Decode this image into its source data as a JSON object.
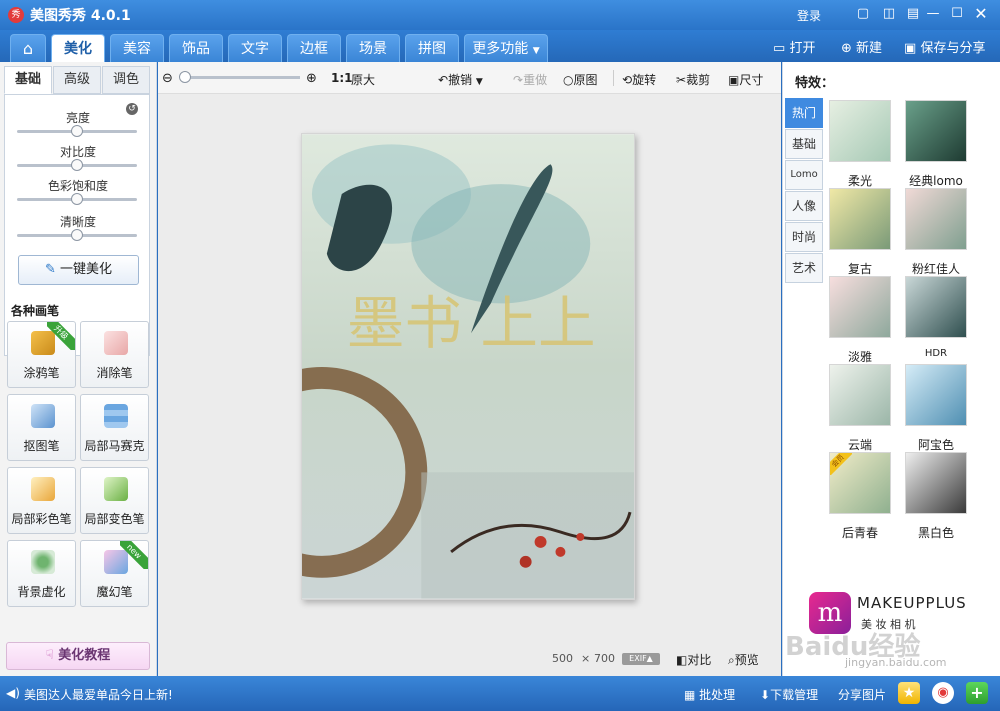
{
  "app": {
    "title": "美图秀秀 4.0.1",
    "logo_char": "秀",
    "login": "登录"
  },
  "window_controls": [
    "chat-icon",
    "skin-icon",
    "menu-icon",
    "minimize-icon",
    "maximize-icon",
    "close-icon"
  ],
  "nav": {
    "home_icon": "home-icon",
    "tabs": [
      "美化",
      "美容",
      "饰品",
      "文字",
      "边框",
      "场景",
      "拼图",
      "更多功能"
    ],
    "active_tab": "美化",
    "open": "打开",
    "new": "新建",
    "save_share": "保存与分享"
  },
  "left": {
    "subtabs": [
      "基础",
      "高级",
      "调色"
    ],
    "active_subtab": "基础",
    "sliders": [
      {
        "label": "亮度",
        "level": 0.5
      },
      {
        "label": "对比度",
        "level": 0.5
      },
      {
        "label": "色彩饱和度",
        "level": 0.5
      },
      {
        "label": "清晰度",
        "level": 0.5
      }
    ],
    "one_click": "一键美化",
    "brushes_title": "各种画笔",
    "tools": [
      {
        "label": "涂鸦笔",
        "badge": "升级"
      },
      {
        "label": "消除笔",
        "badge": ""
      },
      {
        "label": "抠图笔",
        "badge": ""
      },
      {
        "label": "局部马赛克",
        "badge": ""
      },
      {
        "label": "局部彩色笔",
        "badge": ""
      },
      {
        "label": "局部变色笔",
        "badge": ""
      },
      {
        "label": "背景虚化",
        "badge": ""
      },
      {
        "label": "魔幻笔",
        "badge": "new"
      }
    ],
    "tutorial": "美化教程"
  },
  "toolbar": {
    "zoom_ratio": "1:1",
    "original_size": "原大",
    "undo": "撤销",
    "redo": "重做",
    "original": "原图",
    "rotate": "旋转",
    "crop": "裁剪",
    "size": "尺寸"
  },
  "canvas": {
    "photo_calligraphy": "墨书 上上",
    "width": "500",
    "times": "×",
    "height": "700",
    "exif": "EXIF▲",
    "compare": "对比",
    "preview": "预览"
  },
  "right": {
    "title": "特效：",
    "tabs": [
      "热门",
      "基础",
      "Lomo",
      "人像",
      "时尚",
      "艺术"
    ],
    "active_tab": "热门",
    "effects": [
      {
        "label": "柔光",
        "badge": ""
      },
      {
        "label": "经典lomo",
        "badge": ""
      },
      {
        "label": "复古",
        "badge": ""
      },
      {
        "label": "粉红佳人",
        "badge": ""
      },
      {
        "label": "淡雅",
        "badge": ""
      },
      {
        "label": "HDR",
        "badge": ""
      },
      {
        "label": "云端",
        "badge": ""
      },
      {
        "label": "阿宝色",
        "badge": ""
      },
      {
        "label": "后青春",
        "badge": "会员"
      },
      {
        "label": "黑白色",
        "badge": ""
      }
    ],
    "ad_brand": "MAKEUPPLUS",
    "ad_sub": "美 妆 相 机",
    "watermark": "Baidu经验",
    "watermark_url": "jingyan.baidu.com"
  },
  "status": {
    "message": "美图达人最爱单品今日上新!",
    "batch": "批处理",
    "download": "下载管理",
    "share": "分享图片"
  },
  "colors": {
    "accent": "#2a74c8",
    "title_bar": "#3f8ee0",
    "ad_magenta": "#c0218f"
  }
}
